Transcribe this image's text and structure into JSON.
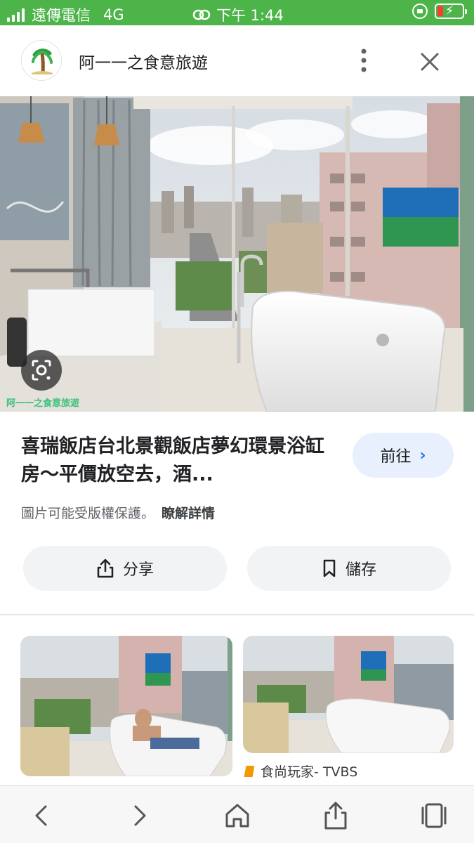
{
  "status_bar": {
    "carrier": "遠傳電信",
    "network": "4G",
    "time": "下午 1:44"
  },
  "header": {
    "site_name": "阿一一之食意旅遊",
    "more_icon": "more-vertical-icon",
    "close_icon": "close-icon"
  },
  "hero": {
    "watermark": "阿一一之食意旅遊",
    "lens_icon": "google-lens-icon"
  },
  "result": {
    "title": "喜瑞飯店台北景觀飯店夢幻環景浴缸房～平價放空去，酒...",
    "visit_label": "前往",
    "copyright_text": "圖片可能受版權保護。",
    "learn_more": "瞭解詳情"
  },
  "actions": {
    "share_label": "分享",
    "save_label": "儲存"
  },
  "related": {
    "item2_source": "食尚玩家- TVBS"
  },
  "colors": {
    "status_bar": "#4cb449",
    "accent": "#1a73e8",
    "visit_bg": "#e8f0fe",
    "button_bg": "#f1f3f4"
  }
}
